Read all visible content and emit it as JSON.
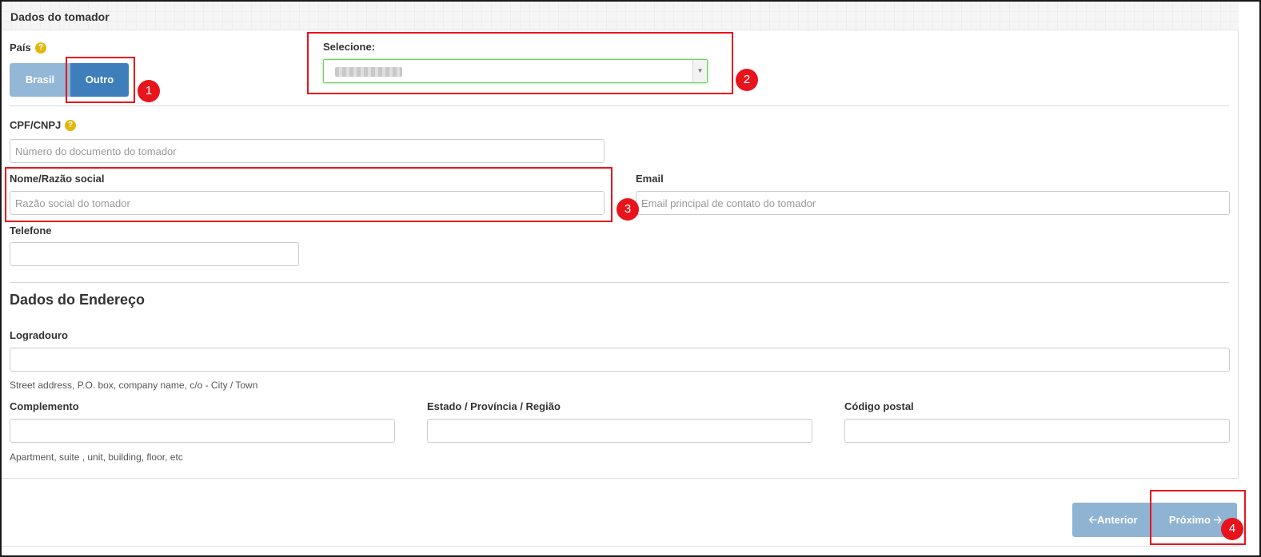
{
  "panel": {
    "title": "Dados do tomador"
  },
  "country": {
    "label": "País",
    "help_icon": "question-circle-icon",
    "buttons": [
      "Brasil",
      "Outro"
    ],
    "selected": "Outro"
  },
  "select": {
    "label": "Selecione:",
    "value_visible": "blurred"
  },
  "fields": {
    "cpf_cnpj": {
      "label": "CPF/CNPJ",
      "placeholder": "Número do documento do tomador"
    },
    "nome": {
      "label": "Nome/Razão social",
      "placeholder": "Razão social do tomador"
    },
    "email": {
      "label": "Email",
      "placeholder": "Email principal de contato do tomador"
    },
    "telefone": {
      "label": "Telefone",
      "placeholder": ""
    }
  },
  "address": {
    "title": "Dados do Endereço",
    "logradouro": {
      "label": "Logradouro",
      "help": "Street address, P.O. box, company name, c/o - City / Town"
    },
    "complemento": {
      "label": "Complemento",
      "help": "Apartment, suite , unit, building, floor, etc"
    },
    "estado": {
      "label": "Estado / Província / Região"
    },
    "codigo_postal": {
      "label": "Código postal"
    }
  },
  "nav": {
    "previous": "Anterior",
    "next": "Próximo"
  },
  "annotations": [
    "1",
    "2",
    "3",
    "4"
  ],
  "colors": {
    "primary": "#3e7fbb",
    "primary_light": "#8fb3d3",
    "annotation": "#e8141c",
    "help_icon": "#e2b80d"
  }
}
